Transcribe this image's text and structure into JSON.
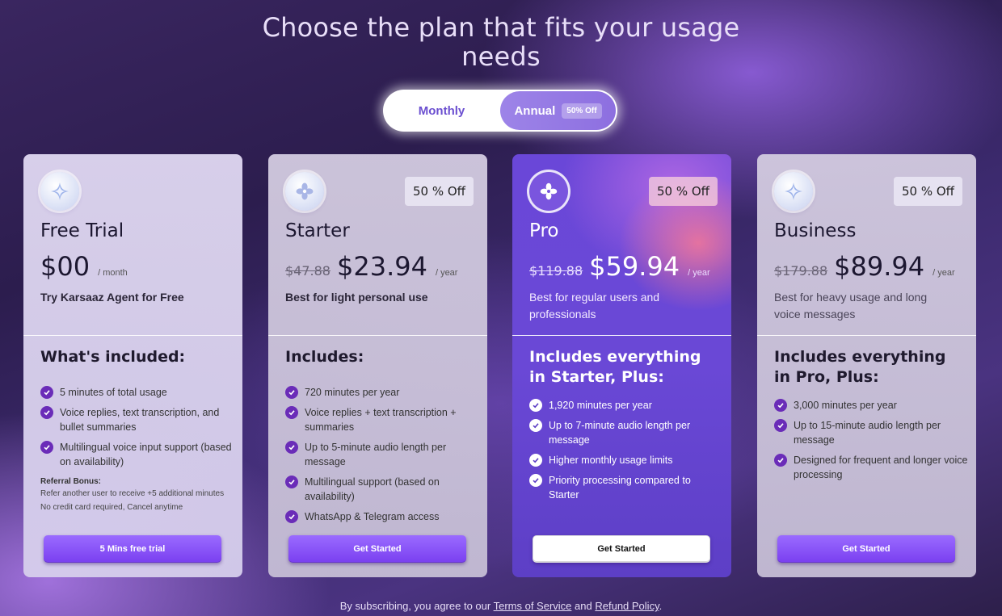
{
  "header": {
    "title_line1": "Choose the plan that fits your usage",
    "title_line2": "needs"
  },
  "billing_toggle": {
    "monthly_label": "Monthly",
    "annual_label": "Annual",
    "annual_badge": "50% Off",
    "selected": "Annual"
  },
  "colors": {
    "accent": "#7a3ff0",
    "check": "#6a2cb8",
    "pro_card": "#6a47d8"
  },
  "plans": [
    {
      "icon": "sparkle-icon",
      "name": "Free Trial",
      "price": "$00",
      "period": "/ month",
      "tagline": "Try Karsaaz Agent for Free",
      "includes_title": "What's included:",
      "features": [
        "5 minutes of total usage",
        "Voice replies, text transcription, and bullet summaries",
        "Multilingual voice input support (based on availability)"
      ],
      "referral": {
        "title": "Referral Bonus:",
        "text": "Refer another user to receive +5 additional minutes",
        "note": "No credit card required, Cancel anytime"
      },
      "cta": "5 Mins free trial"
    },
    {
      "icon": "flower-icon",
      "badge": "50 % Off",
      "name": "Starter",
      "old_price": "$47.88",
      "price": "$23.94",
      "period": "/ year",
      "tagline": "Best for light personal use",
      "includes_title": "Includes:",
      "features": [
        "720 minutes per year",
        "Voice replies + text transcription + summaries",
        "Up to 5-minute audio length per message",
        "Multilingual support (based on availability)",
        "WhatsApp & Telegram access"
      ],
      "cta": "Get Started"
    },
    {
      "icon": "flower-icon",
      "badge": "50 % Off",
      "name": "Pro",
      "old_price": "$119.88",
      "price": "$59.94",
      "period": "/ year",
      "tagline": "Best for regular users and professionals",
      "includes_title": "Includes everything in Starter, Plus:",
      "features": [
        "1,920 minutes per year",
        "Up to 7-minute audio length per message",
        "Higher monthly usage limits",
        "Priority processing compared to Starter"
      ],
      "cta": "Get Started"
    },
    {
      "icon": "sparkle-icon",
      "badge": "50 % Off",
      "name": "Business",
      "old_price": "$179.88",
      "price": "$89.94",
      "period": "/ year",
      "tagline": "Best for heavy usage and long voice messages",
      "includes_title": "Includes everything in Pro, Plus:",
      "features": [
        "3,000 minutes per year",
        "Up to 15-minute audio length per message",
        "Designed for frequent and longer voice processing"
      ],
      "cta": "Get Started"
    }
  ],
  "footer": {
    "prefix": "By subscribing, you agree to our",
    "terms": "Terms of Service",
    "and": "and",
    "refund": "Refund Policy",
    "suffix": "."
  }
}
